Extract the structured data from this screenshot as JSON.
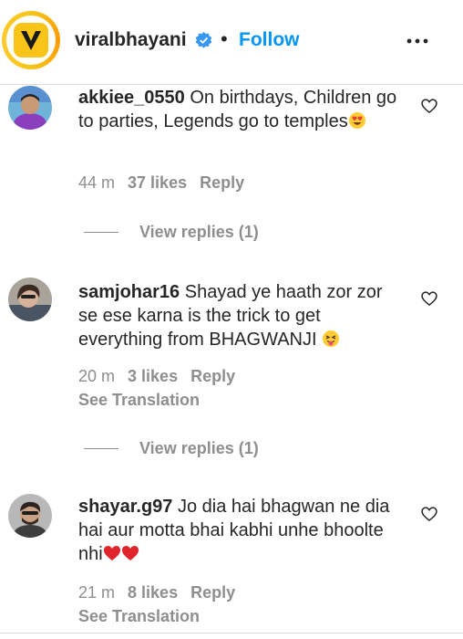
{
  "header": {
    "username": "viralbhayani",
    "separator": "•",
    "follow_label": "Follow",
    "logo_letter": "V",
    "colors": {
      "follow": "#0095f6",
      "verified": "#3897f0",
      "logo_ring": "#f5c518"
    }
  },
  "comments": [
    {
      "username": "akkiee_0550",
      "text": "On birthdays, Children go to parties, Legends go to temples",
      "emoji": "heart-eyes-emoji",
      "time": "44 m",
      "likes": "37 likes",
      "reply": "Reply",
      "view_replies": "View replies (1)"
    },
    {
      "username": "samjohar16",
      "text": "Shayad ye haath zor zor se ese karna is the trick to get everything from BHAGWANJI",
      "emoji": "tongue-wink-emoji",
      "time": "20 m",
      "likes": "3 likes",
      "reply": "Reply",
      "see_translation": "See Translation",
      "view_replies": "View replies (1)"
    },
    {
      "username": "shayar.g97",
      "text": "Jo dia hai bhagwan ne dia hai aur motta bhai kabhi unhe bhoolte nhi",
      "emoji": "two-red-hearts-emoji",
      "time": "21 m",
      "likes": "8 likes",
      "reply": "Reply",
      "see_translation": "See Translation"
    }
  ]
}
